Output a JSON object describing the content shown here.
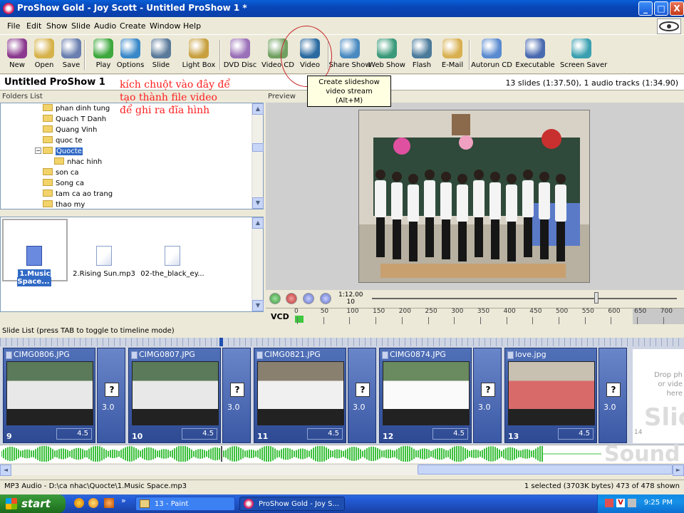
{
  "window": {
    "title": "ProShow Gold - Joy Scott - Untitled ProShow 1 *",
    "minimize": "_",
    "maximize": "□",
    "close": "X"
  },
  "menu": [
    "File",
    "Edit",
    "Show",
    "Slide",
    "Audio",
    "Create",
    "Window",
    "Help"
  ],
  "toolbar": {
    "buttons": [
      {
        "label": "New",
        "icon": "new-show-icon",
        "color": "#8b3a8f"
      },
      {
        "label": "Open",
        "icon": "open-folder-icon",
        "color": "#d6b24a"
      },
      {
        "label": "Save",
        "icon": "save-disk-icon",
        "color": "#6a7fb0"
      },
      {
        "label": "Play",
        "icon": "play-icon",
        "color": "#3da83d"
      },
      {
        "label": "Options",
        "icon": "options-globe-icon",
        "color": "#3a88c8"
      },
      {
        "label": "Slide",
        "icon": "slide-film-icon",
        "color": "#5a7a9a"
      },
      {
        "label": "Light Box",
        "icon": "light-box-icon",
        "color": "#c8a040"
      },
      {
        "label": "DVD Disc",
        "icon": "dvd-disc-icon",
        "color": "#9a70b8"
      },
      {
        "label": "Video CD",
        "icon": "video-cd-icon",
        "color": "#70a060"
      },
      {
        "label": "Video",
        "icon": "video-clapper-icon",
        "color": "#2a6aa0"
      },
      {
        "label": "Share Show",
        "icon": "share-show-icon",
        "color": "#4a8ac0"
      },
      {
        "label": "Web Show",
        "icon": "web-show-icon",
        "color": "#3a9a7a"
      },
      {
        "label": "Flash",
        "icon": "flash-icon",
        "color": "#4a7a9a"
      },
      {
        "label": "E-Mail",
        "icon": "email-envelope-icon",
        "color": "#d8b050"
      },
      {
        "label": "Autorun CD",
        "icon": "autorun-cd-icon",
        "color": "#5a8ad0"
      },
      {
        "label": "Executable",
        "icon": "executable-icon",
        "color": "#4a6ab0"
      },
      {
        "label": "Screen Saver",
        "icon": "screen-saver-icon",
        "color": "#3aa0b0"
      }
    ]
  },
  "show": {
    "title": "Untitled ProShow 1",
    "info": "13 slides (1:37.50), 1 audio tracks (1:34.90)"
  },
  "annotation": {
    "lines": [
      "kích chuột vào đây để",
      "tạo thành file video",
      "để ghi ra đĩa hình"
    ],
    "tooltip": [
      "Create slideshow",
      "video stream",
      "(Alt+M)"
    ]
  },
  "folders": {
    "header": "Folders List",
    "items": [
      {
        "label": "phan dinh tung"
      },
      {
        "label": "Quach T Danh"
      },
      {
        "label": "Quang Vinh"
      },
      {
        "label": "quoc te"
      },
      {
        "label": "Quocte",
        "selected": true,
        "expand": "−"
      },
      {
        "label": "nhac hinh",
        "child": true
      },
      {
        "label": "son ca"
      },
      {
        "label": "Song ca"
      },
      {
        "label": "tam ca ao trang"
      },
      {
        "label": "thao my"
      }
    ]
  },
  "files": [
    {
      "label": "1.Music Space...",
      "selected": true
    },
    {
      "label": "2.Rising Sun.mp3"
    },
    {
      "label": "02-the_black_ey..."
    }
  ],
  "preview": {
    "header": "Preview",
    "timecode_top": "1:12.00",
    "timecode_bottom": "10",
    "format": "VCD",
    "ruler": [
      "0",
      "50",
      "100",
      "150",
      "200",
      "250",
      "300",
      "350",
      "400",
      "450",
      "500",
      "550",
      "600",
      "650",
      "700"
    ]
  },
  "slidelist": {
    "header": "Slide List (press TAB to toggle to timeline mode)",
    "slides": [
      {
        "name": "CIMG0806.JPG",
        "number": "9",
        "duration": "4.5"
      },
      {
        "name": "CIMG0807.JPG",
        "number": "10",
        "duration": "4.5"
      },
      {
        "name": "CIMG0821.JPG",
        "number": "11",
        "duration": "4.5"
      },
      {
        "name": "CIMG0874.JPG",
        "number": "12",
        "duration": "4.5"
      },
      {
        "name": "love.jpg",
        "number": "13",
        "duration": "4.5"
      }
    ],
    "transitions": [
      {
        "symbol": "?",
        "duration": "3.0"
      },
      {
        "symbol": "?",
        "duration": "3.0"
      },
      {
        "symbol": "?",
        "duration": "3.0"
      },
      {
        "symbol": "?",
        "duration": "3.0"
      },
      {
        "symbol": "?",
        "duration": "3.0"
      }
    ],
    "dropzone": [
      "Drop ph",
      "or vide",
      "here"
    ],
    "dropzone_big": "Slic",
    "next_number": "14"
  },
  "audio": {
    "sound_big": "Sound"
  },
  "status": {
    "left": "MP3 Audio - D:\\ca nhac\\Quocte\\1.Music Space.mp3",
    "right": "1 selected (3703K bytes) 473 of 478 shown"
  },
  "taskbar": {
    "start": "start",
    "tasks": [
      "13 - Paint",
      "ProShow Gold - Joy S..."
    ],
    "clock": "9:25 PM",
    "quick_launch": "»"
  }
}
